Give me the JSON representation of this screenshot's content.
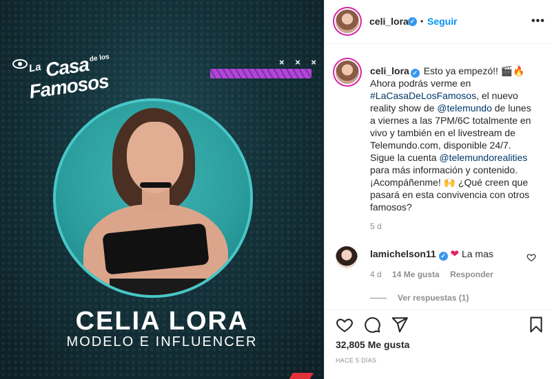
{
  "media": {
    "logo": {
      "la": "La",
      "casa": "Casa",
      "de_los": "de los",
      "famosos": "Famosos"
    },
    "decor_marks": "× × ×",
    "name": "CELIA LORA",
    "subtitle": "MODELO E INFLUENCER",
    "colors": {
      "ring": "#48c7c7",
      "stripe": "#b146d8",
      "background": "#133139"
    }
  },
  "header": {
    "username": "celi_lora",
    "verified_mark": "✓",
    "separator": "•",
    "follow_label": "Seguir",
    "more_label": "•••"
  },
  "caption": {
    "username": "celi_lora",
    "verified_mark": "✓",
    "text_1": " Esto ya empezó!! 🎬🔥\nAhora podrás verme en\n",
    "hashtag": "#LaCasaDeLosFamosos",
    "text_2": ", el nuevo\nreality show de ",
    "mention_1": "@telemundo",
    "text_3": " de lunes\na viernes a las 7PM/6C totalmente en\nvivo y también en el livestream de\nTelemundo.com, disponible 24/7.\nSigue la cuenta ",
    "mention_2": "@telemundorealities",
    "text_4": "\npara más información y contenido.\n¡Acompáñenme! 🙌 ¿Qué creen que\npasará en esta convivencia con otros\nfamosos?",
    "age": "5 d"
  },
  "comment": {
    "username": "lamichelson11",
    "verified_mark": "✓",
    "emoji": "❤",
    "text": "La mas",
    "age": "4 d",
    "likes": "14 Me gusta",
    "reply_label": "Responder",
    "view_replies": "Ver respuestas (1)"
  },
  "actions": {
    "likes": "32,805 Me gusta",
    "time": "HACE 5 DÍAS",
    "icons": [
      "heart-icon",
      "comment-icon",
      "share-icon",
      "bookmark-icon"
    ]
  }
}
